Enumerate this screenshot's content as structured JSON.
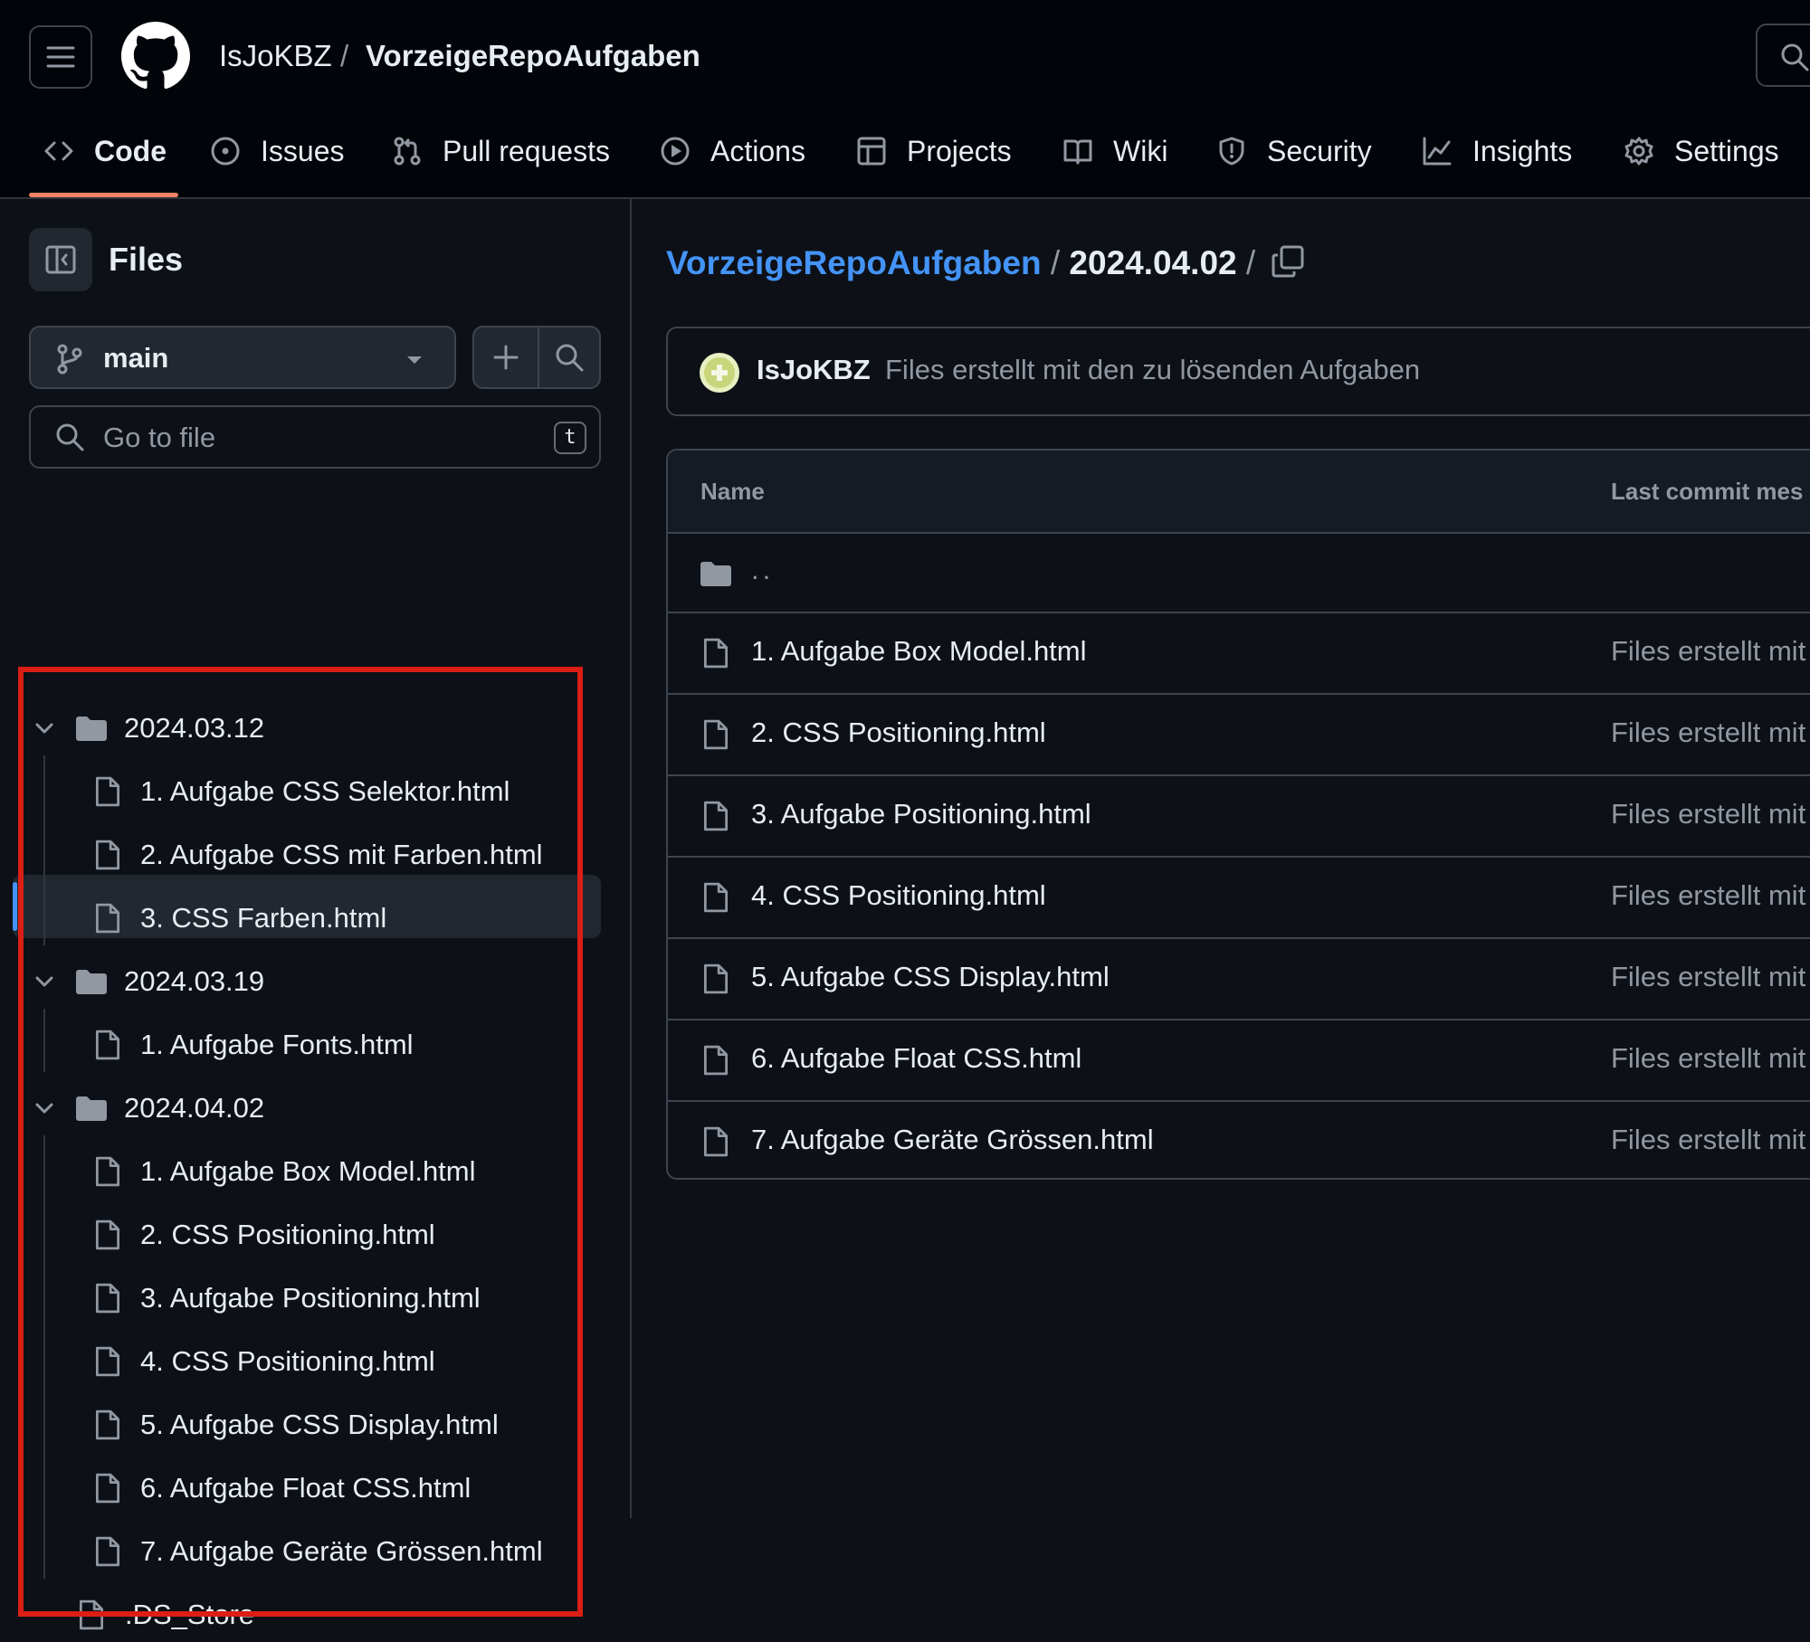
{
  "header": {
    "owner": "IsJoKBZ",
    "separator": "/",
    "repo": "VorzeigeRepoAufgaben"
  },
  "tabs": [
    {
      "label": "Code",
      "icon": "code-icon"
    },
    {
      "label": "Issues",
      "icon": "issue-icon"
    },
    {
      "label": "Pull requests",
      "icon": "pull-request-icon"
    },
    {
      "label": "Actions",
      "icon": "play-icon"
    },
    {
      "label": "Projects",
      "icon": "table-icon"
    },
    {
      "label": "Wiki",
      "icon": "book-icon"
    },
    {
      "label": "Security",
      "icon": "shield-icon"
    },
    {
      "label": "Insights",
      "icon": "graph-icon"
    },
    {
      "label": "Settings",
      "icon": "gear-icon"
    }
  ],
  "sidebar": {
    "title": "Files",
    "branch": "main",
    "goto_placeholder": "Go to file",
    "goto_shortcut": "t",
    "tree": [
      {
        "label": "2024.03.12",
        "type": "folder"
      },
      {
        "label": "1. Aufgabe CSS Selektor.html",
        "type": "file"
      },
      {
        "label": "2. Aufgabe CSS mit Farben.html",
        "type": "file"
      },
      {
        "label": "3. CSS Farben.html",
        "type": "file"
      },
      {
        "label": "2024.03.19",
        "type": "folder"
      },
      {
        "label": "1. Aufgabe Fonts.html",
        "type": "file"
      },
      {
        "label": "2024.04.02",
        "type": "folder"
      },
      {
        "label": "1. Aufgabe Box Model.html",
        "type": "file"
      },
      {
        "label": "2. CSS Positioning.html",
        "type": "file"
      },
      {
        "label": "3. Aufgabe Positioning.html",
        "type": "file"
      },
      {
        "label": "4. CSS Positioning.html",
        "type": "file"
      },
      {
        "label": "5. Aufgabe CSS Display.html",
        "type": "file"
      },
      {
        "label": "6. Aufgabe Float CSS.html",
        "type": "file"
      },
      {
        "label": "7. Aufgabe Geräte Grössen.html",
        "type": "file"
      },
      {
        "label": ".DS_Store",
        "type": "file"
      }
    ]
  },
  "main": {
    "path_repo": "VorzeigeRepoAufgaben",
    "path_sep": "/",
    "path_folder": "2024.04.02",
    "path_trailing": "/",
    "commit": {
      "author": "IsJoKBZ",
      "message": "Files erstellt mit den zu lösenden Aufgaben"
    },
    "table": {
      "col_name": "Name",
      "col_commit": "Last commit mes",
      "parent": "..",
      "rows": [
        {
          "name": "1. Aufgabe Box Model.html",
          "message": "Files erstellt mit"
        },
        {
          "name": "2. CSS Positioning.html",
          "message": "Files erstellt mit"
        },
        {
          "name": "3. Aufgabe Positioning.html",
          "message": "Files erstellt mit"
        },
        {
          "name": "4. CSS Positioning.html",
          "message": "Files erstellt mit"
        },
        {
          "name": "5. Aufgabe CSS Display.html",
          "message": "Files erstellt mit"
        },
        {
          "name": "6. Aufgabe Float CSS.html",
          "message": "Files erstellt mit"
        },
        {
          "name": "7. Aufgabe Geräte Grössen.html",
          "message": "Files erstellt mit"
        }
      ]
    }
  },
  "colors": {
    "accent_link": "#4493f8",
    "highlight_border": "#da1f16",
    "tab_underline": "#f78166"
  }
}
